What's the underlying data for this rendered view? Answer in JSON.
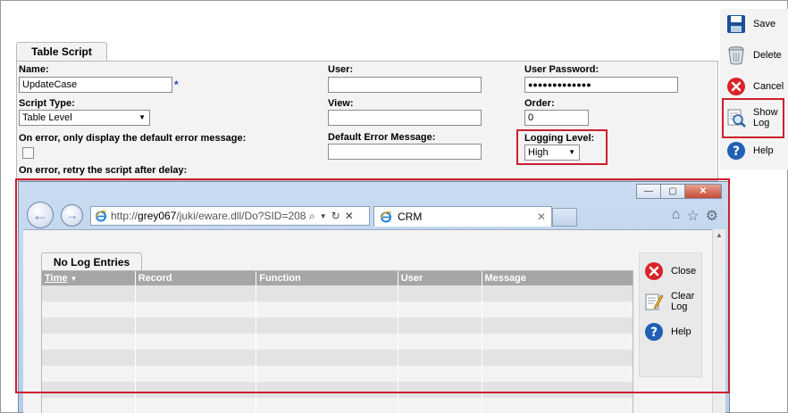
{
  "form": {
    "tab_label": "Table Script",
    "name_label": "Name:",
    "name_value": "UpdateCase",
    "required_marker": "*",
    "script_type_label": "Script Type:",
    "script_type_value": "Table Level",
    "on_error_label": "On error, only display the default error message:",
    "retry_label": "On error, retry the script after delay:",
    "user_label": "User:",
    "user_value": "",
    "view_label": "View:",
    "view_value": "",
    "default_error_label": "Default Error Message:",
    "default_error_value": "",
    "user_password_label": "User Password:",
    "user_password_value": "●●●●●●●●●●●●●",
    "order_label": "Order:",
    "order_value": "0",
    "logging_level_label": "Logging Level:",
    "logging_level_value": "High"
  },
  "actions": [
    {
      "label": "Save",
      "icon": "save-icon"
    },
    {
      "label": "Delete",
      "icon": "trash-icon"
    },
    {
      "label": "Cancel",
      "icon": "cancel-icon"
    },
    {
      "label_line1": "Show",
      "label_line2": "Log",
      "icon": "show-log-icon"
    },
    {
      "label": "Help",
      "icon": "help-icon"
    }
  ],
  "browser": {
    "window_controls": {
      "minimize": "—",
      "maximize": "▢",
      "close": "✕"
    },
    "address_prefix": "http://",
    "address_host": "grey067",
    "address_path": "/juki/eware.dll/Do?SID=208",
    "tab_title": "CRM",
    "tab_close": "✕"
  },
  "log": {
    "tab_label": "No Log Entries",
    "columns": [
      "Time",
      "Record",
      "Function",
      "User",
      "Message"
    ],
    "sort_indicator": "▼",
    "actions": [
      {
        "label": "Close",
        "icon": "close-circle-icon"
      },
      {
        "label_line1": "Clear",
        "label_line2": "Log",
        "icon": "clear-log-icon"
      },
      {
        "label": "Help",
        "icon": "help-icon"
      }
    ]
  },
  "colors": {
    "highlight": "#cc1f2e",
    "panel": "#f3f3f3",
    "grid_header": "#a6a6a6"
  }
}
